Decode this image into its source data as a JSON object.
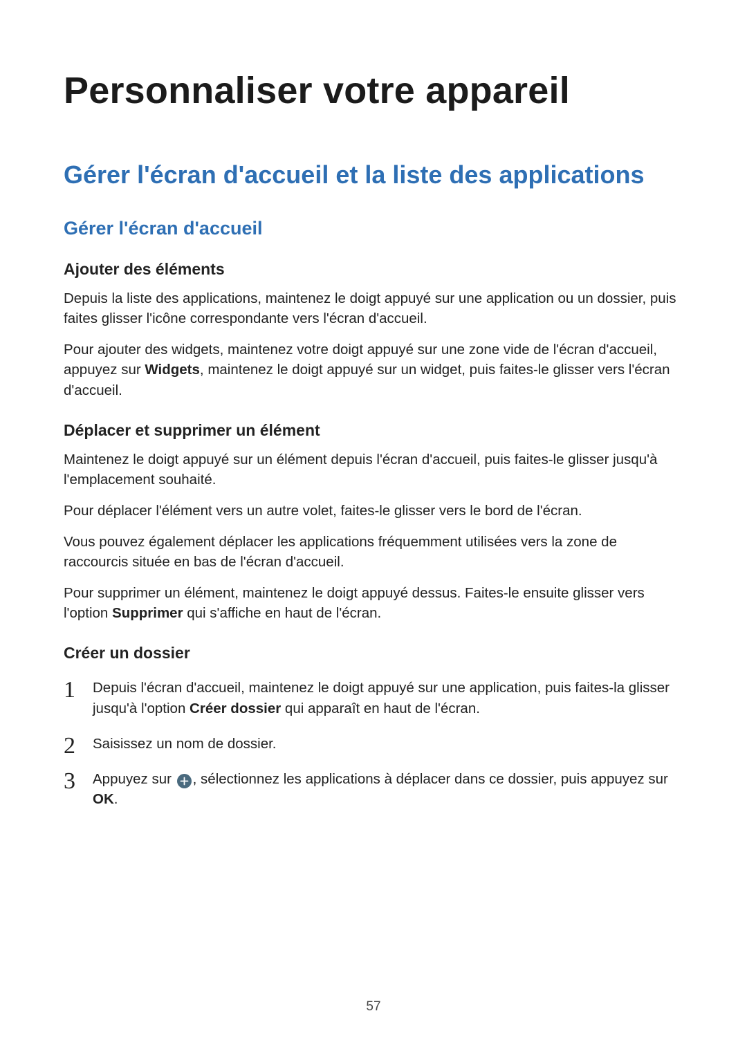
{
  "page_number": "57",
  "title": "Personnaliser votre appareil",
  "section": "Gérer l'écran d'accueil et la liste des applications",
  "subsection": "Gérer l'écran d'accueil",
  "topics": {
    "ajouter": {
      "heading": "Ajouter des éléments",
      "p1": "Depuis la liste des applications, maintenez le doigt appuyé sur une application ou un dossier, puis faites glisser l'icône correspondante vers l'écran d'accueil.",
      "p2_pre": "Pour ajouter des widgets, maintenez votre doigt appuyé sur une zone vide de l'écran d'accueil, appuyez sur ",
      "p2_bold": "Widgets",
      "p2_post": ", maintenez le doigt appuyé sur un widget, puis faites-le glisser vers l'écran d'accueil."
    },
    "deplacer": {
      "heading": "Déplacer et supprimer un élément",
      "p1": "Maintenez le doigt appuyé sur un élément depuis l'écran d'accueil, puis faites-le glisser jusqu'à l'emplacement souhaité.",
      "p2": "Pour déplacer l'élément vers un autre volet, faites-le glisser vers le bord de l'écran.",
      "p3": "Vous pouvez également déplacer les applications fréquemment utilisées vers la zone de raccourcis située en bas de l'écran d'accueil.",
      "p4_pre": "Pour supprimer un élément, maintenez le doigt appuyé dessus. Faites-le ensuite glisser vers l'option ",
      "p4_bold": "Supprimer",
      "p4_post": " qui s'affiche en haut de l'écran."
    },
    "creer": {
      "heading": "Créer un dossier",
      "steps": [
        {
          "pre": "Depuis l'écran d'accueil, maintenez le doigt appuyé sur une application, puis faites-la glisser jusqu'à l'option ",
          "bold": "Créer dossier",
          "post": " qui apparaît en haut de l'écran."
        },
        {
          "text": "Saisissez un nom de dossier."
        },
        {
          "pre": "Appuyez sur ",
          "mid": ", sélectionnez les applications à déplacer dans ce dossier, puis appuyez sur ",
          "bold": "OK",
          "post": "."
        }
      ]
    }
  }
}
